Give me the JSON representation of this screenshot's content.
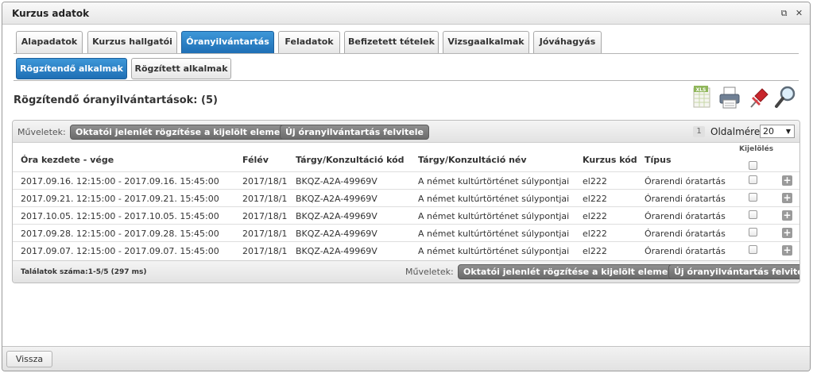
{
  "window": {
    "title": "Kurzus adatok",
    "popout_icon": "⧉",
    "close_icon": "✕"
  },
  "tabs": [
    {
      "label": "Alapadatok",
      "active": false
    },
    {
      "label": "Kurzus hallgatói",
      "active": false
    },
    {
      "label": "Óranyilvántartás",
      "active": true
    },
    {
      "label": "Feladatok",
      "active": false
    },
    {
      "label": "Befizetett tételek",
      "active": false
    },
    {
      "label": "Vizsgaalkalmak",
      "active": false
    },
    {
      "label": "Jóváhagyás",
      "active": false
    }
  ],
  "subtabs": [
    {
      "label": "Rögzítendő alkalmak",
      "active": true
    },
    {
      "label": "Rögzített alkalmak",
      "active": false
    }
  ],
  "section_title": "Rögzítendő óranyilvántartások: (5)",
  "toolbar": {
    "xls_label": "XLS"
  },
  "grid": {
    "ops_label": "Műveletek:",
    "op1": "Oktatói jelenlét rögzítése a kijelölt elemekhez",
    "op2": "Új óranyilvántartás felvitele",
    "page_number": "1",
    "page_size_label": "Oldalméret",
    "page_size_value": "20",
    "select_header": "Kijelölés",
    "columns": [
      "Óra kezdete - vége",
      "Félév",
      "Tárgy/Konzultáció kód",
      "Tárgy/Konzultáció név",
      "Kurzus kód",
      "Típus"
    ],
    "rows": [
      [
        "2017.09.16. 12:15:00 - 2017.09.16. 15:45:00",
        "2017/18/1",
        "BKQZ-A2A-49969V",
        "A német kultúrtörténet súlypontjai",
        "el222",
        "Órarendi óratartás"
      ],
      [
        "2017.09.21. 12:15:00 - 2017.09.21. 15:45:00",
        "2017/18/1",
        "BKQZ-A2A-49969V",
        "A német kultúrtörténet súlypontjai",
        "el222",
        "Órarendi óratartás"
      ],
      [
        "2017.10.05. 12:15:00 - 2017.10.05. 15:45:00",
        "2017/18/1",
        "BKQZ-A2A-49969V",
        "A német kultúrtörténet súlypontjai",
        "el222",
        "Órarendi óratartás"
      ],
      [
        "2017.09.28. 12:15:00 - 2017.09.28. 15:45:00",
        "2017/18/1",
        "BKQZ-A2A-49969V",
        "A német kultúrtörténet súlypontjai",
        "el222",
        "Órarendi óratartás"
      ],
      [
        "2017.09.07. 12:15:00 - 2017.09.07. 15:45:00",
        "2017/18/1",
        "BKQZ-A2A-49969V",
        "A német kultúrtörténet súlypontjai",
        "el222",
        "Órarendi óratartás"
      ]
    ],
    "results": "Találatok száma:1-5/5 (297 ms)"
  },
  "footer": {
    "back_label": "Vissza"
  },
  "colors": {
    "accent": "#1f6fb5",
    "op_button": "#6f6f6f"
  }
}
